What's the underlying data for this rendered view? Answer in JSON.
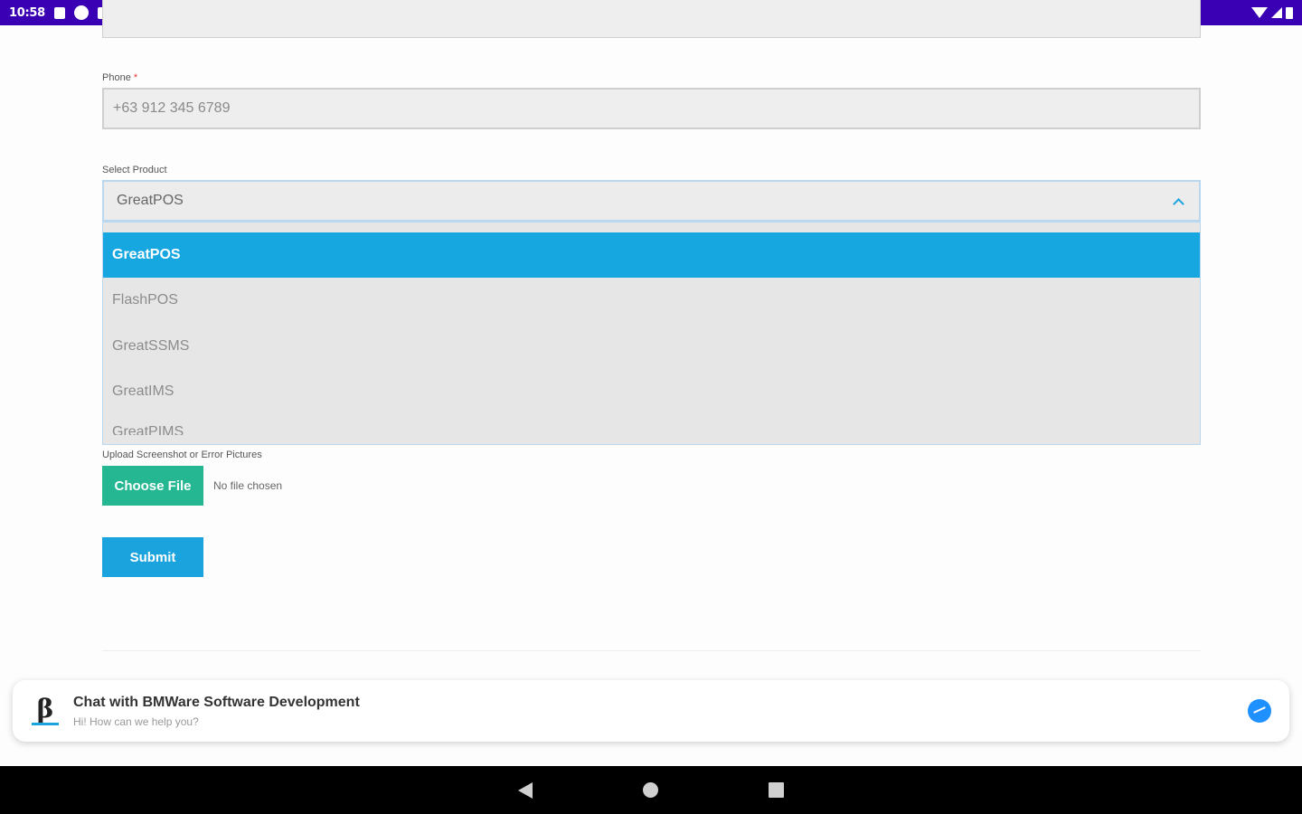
{
  "status_bar": {
    "time": "10:58",
    "background": "#3a00b4",
    "left_icons": [
      "notification-icon",
      "pinterest-icon",
      "sd-card-icon"
    ],
    "right_icons": [
      "wifi-icon",
      "signal-icon",
      "battery-icon"
    ]
  },
  "form": {
    "phone": {
      "label": "Phone",
      "required_mark": "*",
      "placeholder": "+63 912 345 6789"
    },
    "product": {
      "label": "Select Product",
      "selected": "GreatPOS",
      "options": [
        "GreatPOS",
        "FlashPOS",
        "GreatSSMS",
        "GreatIMS",
        "GreatPIMS"
      ]
    },
    "upload": {
      "label": "Upload Screenshot or Error Pictures",
      "button_label": "Choose File",
      "status": "No file chosen"
    },
    "submit_label": "Submit"
  },
  "chat_widget": {
    "title": "Chat with BMWare Software Development",
    "subtitle": "Hi! How can we help you?",
    "logo_glyph": "β"
  },
  "colors": {
    "accent": "#1ba3dd",
    "selected_option": "#17a7e0",
    "choose_file": "#24b792",
    "status_bar": "#3a00b4"
  }
}
